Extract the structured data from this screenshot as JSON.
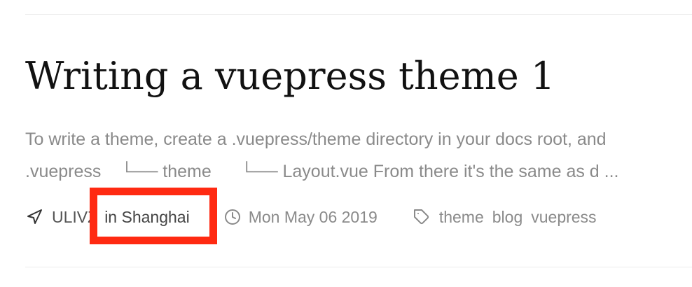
{
  "post": {
    "title": "Writing a vuepress theme 1",
    "excerpt_line1": "To write a theme, create a .vuepress/theme directory in your docs root, and",
    "excerpt_line2": ".vuepress    └── theme      └── Layout.vue From there it's the same as d ...",
    "author": "ULIVZ",
    "location": "in Shanghai",
    "date": "Mon May 06 2019",
    "tags": [
      "theme",
      "blog",
      "vuepress"
    ]
  },
  "icons": {
    "author": "navigation-arrow-icon",
    "date": "clock-icon",
    "tags": "tag-icon"
  },
  "colors": {
    "title": "#111111",
    "muted_text": "#8a8a8a",
    "highlight_box": "#ff2a12",
    "divider": "#ececec"
  }
}
